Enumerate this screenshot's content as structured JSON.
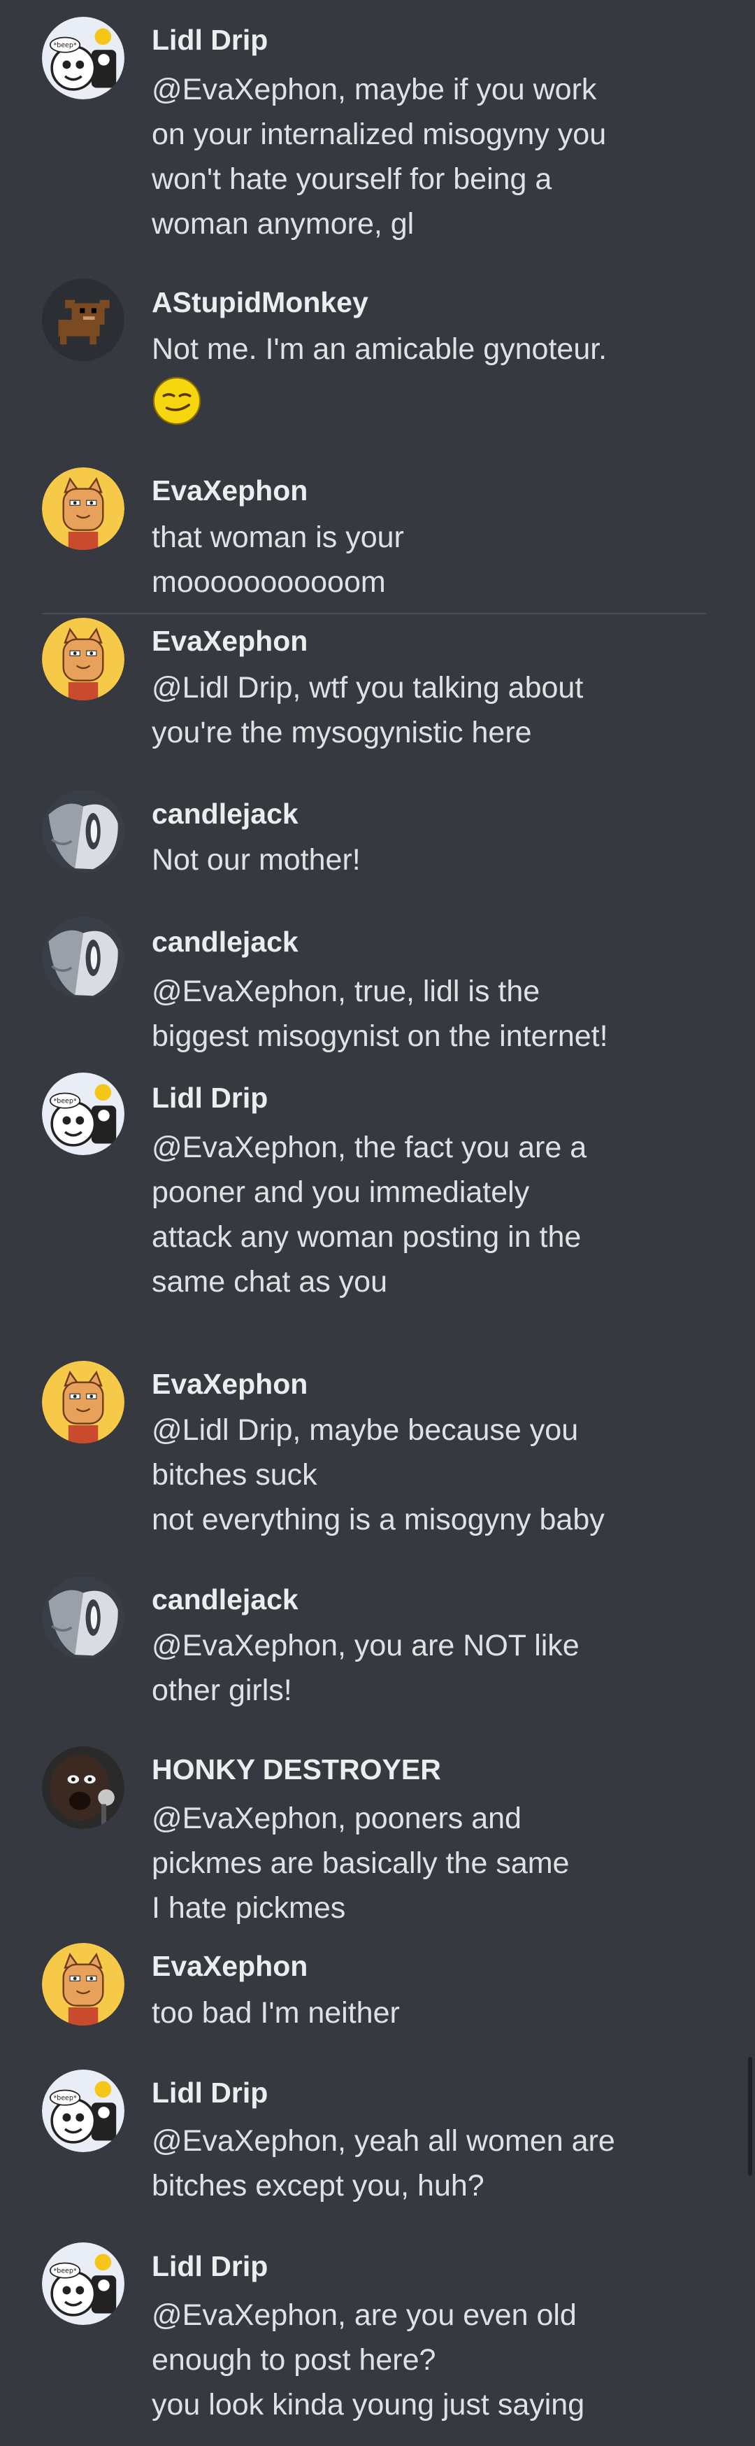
{
  "messages": [
    {
      "author": "Lidl Drip",
      "avatar": "lidl",
      "lines": [
        "@EvaXephon, maybe if you work",
        "on your internalized misogyny you",
        "won't hate yourself for being a",
        "woman anymore, gl"
      ]
    },
    {
      "author": "AStupidMonkey",
      "avatar": "monkey",
      "lines": [
        "Not me. I'm an amicable gynoteur."
      ],
      "emoji": "smirk-emoji"
    },
    {
      "author": "EvaXephon",
      "avatar": "cat",
      "lines": [
        "that woman is your",
        "mooooooooooom"
      ]
    },
    {
      "author": "EvaXephon",
      "avatar": "cat",
      "lines": [
        "@Lidl Drip, wtf you talking about",
        "you're the mysogynistic here"
      ]
    },
    {
      "author": "candlejack",
      "avatar": "candle",
      "lines": [
        "Not our mother!"
      ]
    },
    {
      "author": "candlejack",
      "avatar": "candle",
      "lines": [
        "@EvaXephon, true, lidl is the",
        "biggest misogynist on the internet!"
      ]
    },
    {
      "author": "Lidl Drip",
      "avatar": "lidl",
      "lines": [
        "@EvaXephon, the fact you are a",
        "pooner and you immediately",
        "attack any woman posting in the",
        "same chat as you"
      ]
    },
    {
      "author": "EvaXephon",
      "avatar": "cat",
      "lines": [
        "@Lidl Drip, maybe because you",
        "bitches suck",
        "not everything is a misogyny baby"
      ]
    },
    {
      "author": "candlejack",
      "avatar": "candle",
      "lines": [
        "@EvaXephon, you are NOT like",
        "other girls!"
      ]
    },
    {
      "author": "HONKY DESTROYER",
      "avatar": "honky",
      "lines": [
        "@EvaXephon, pooners and",
        "pickmes are basically the same",
        "I hate pickmes"
      ]
    },
    {
      "author": "EvaXephon",
      "avatar": "cat",
      "lines": [
        "too bad I'm neither"
      ]
    },
    {
      "author": "Lidl Drip",
      "avatar": "lidl",
      "lines": [
        "@EvaXephon, yeah all women are",
        "bitches except you, huh?"
      ]
    },
    {
      "author": "Lidl Drip",
      "avatar": "lidl",
      "lines": [
        "@EvaXephon, are you even old",
        "enough to post here?",
        "you look kinda young just saying"
      ]
    }
  ],
  "avatar_labels": {
    "lidl_badge": "*beep*"
  },
  "colors": {
    "background": "#36393f",
    "author": "#ebedef",
    "text": "#e0e1e5",
    "cat_avatar_bg": "#f7c948"
  }
}
